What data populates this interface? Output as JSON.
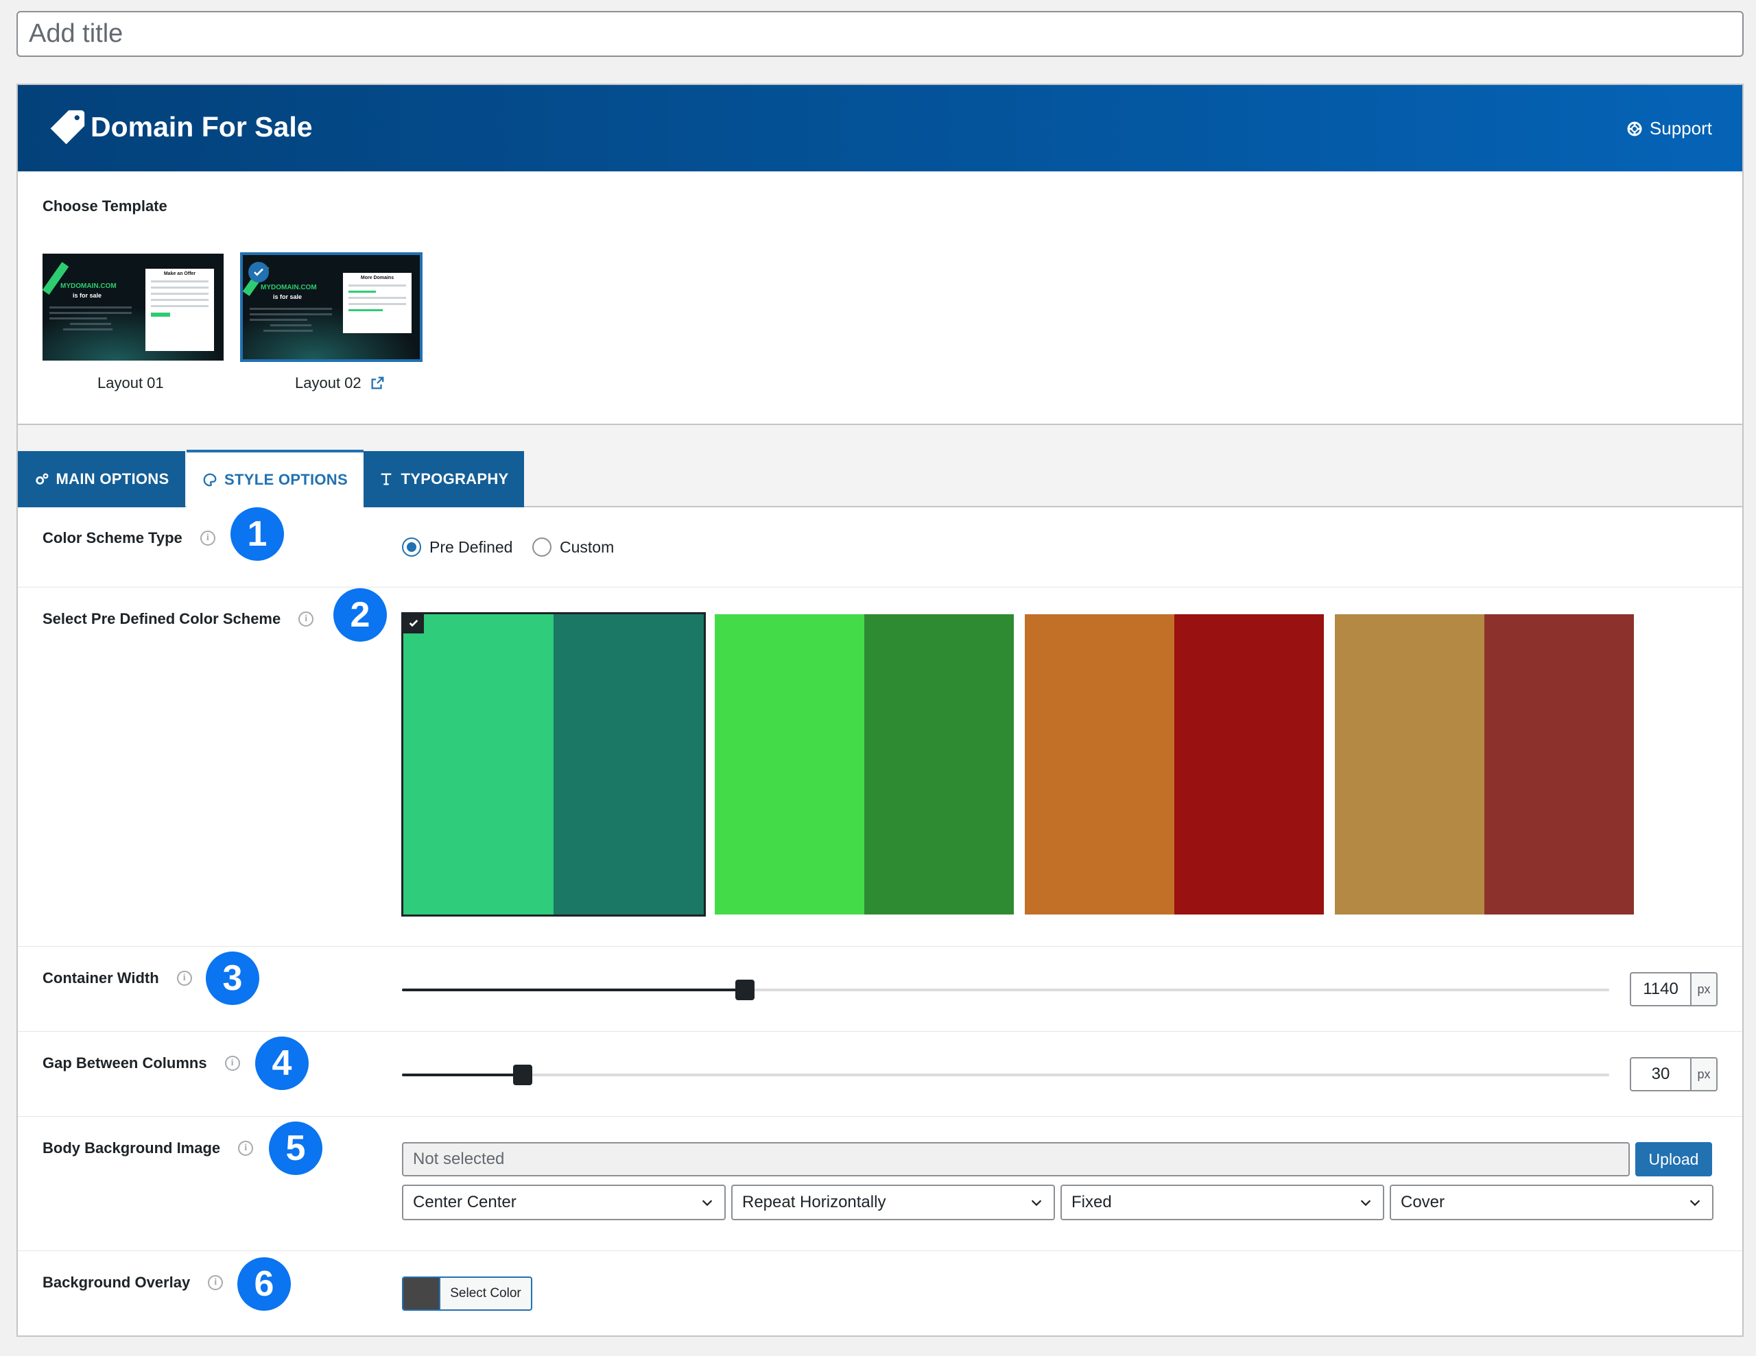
{
  "title_field": {
    "placeholder": "Add title"
  },
  "header": {
    "brand": "Domain For Sale",
    "support": "Support"
  },
  "templates": {
    "label": "Choose Template",
    "items": [
      {
        "caption": "Layout 01",
        "preview_domain": "MYDOMAIN.COM",
        "preview_status": "is for sale",
        "preview_card": "Make an Offer",
        "selected": false
      },
      {
        "caption": "Layout 02",
        "preview_domain": "MYDOMAIN.COM",
        "preview_status": "is for sale",
        "preview_card": "More Domains",
        "selected": true
      }
    ]
  },
  "tabs": [
    {
      "label": "MAIN OPTIONS",
      "icon": "gears-icon",
      "active": false
    },
    {
      "label": "STYLE OPTIONS",
      "icon": "palette-icon",
      "active": true
    },
    {
      "label": "TYPOGRAPHY",
      "icon": "typography-icon",
      "active": false
    }
  ],
  "options": {
    "color_scheme_type": {
      "label": "Color Scheme Type",
      "badge": "1",
      "choices": [
        "Pre Defined",
        "Custom"
      ],
      "selected": "Pre Defined"
    },
    "predefined_scheme": {
      "label": "Select Pre Defined Color Scheme",
      "badge": "2",
      "schemes": [
        {
          "colors": [
            "#2ecc7b",
            "#1a7865"
          ],
          "selected": true
        },
        {
          "colors": [
            "#44db48",
            "#2f8b32"
          ],
          "selected": false
        },
        {
          "colors": [
            "#c27028",
            "#9a1111"
          ],
          "selected": false
        },
        {
          "colors": [
            "#b38944",
            "#8c312c"
          ],
          "selected": false
        }
      ]
    },
    "container_width": {
      "label": "Container Width",
      "badge": "3",
      "value": "1140",
      "unit": "px",
      "min": 0,
      "max": 4000,
      "level": 0.284
    },
    "gap_columns": {
      "label": "Gap Between Columns",
      "badge": "4",
      "value": "30",
      "unit": "px",
      "min": 0,
      "max": 500,
      "level": 0.1
    },
    "body_bg_image": {
      "label": "Body Background Image",
      "badge": "5",
      "file_value": "Not selected",
      "upload_label": "Upload",
      "position": "Center Center",
      "repeat": "Repeat Horizontally",
      "attachment": "Fixed",
      "size": "Cover"
    },
    "bg_overlay": {
      "label": "Background Overlay",
      "badge": "6",
      "button_label": "Select Color",
      "swatch": "#464646"
    }
  },
  "colors": {
    "accent": "#2271b1",
    "badge": "#0a74f1",
    "header_start": "#03417a",
    "header_end": "#0563b6"
  }
}
